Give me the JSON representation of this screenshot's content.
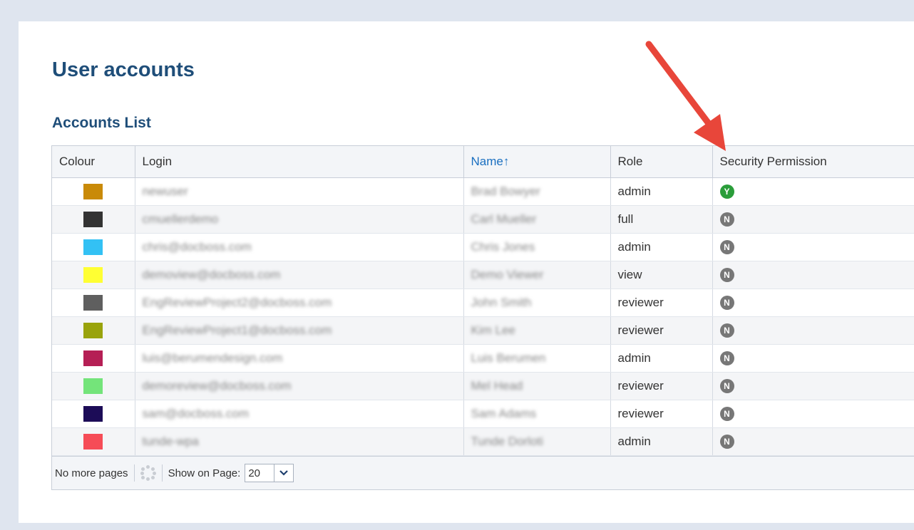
{
  "page": {
    "title": "User accounts",
    "section_title": "Accounts List"
  },
  "table": {
    "columns": {
      "colour": "Colour",
      "login": "Login",
      "name": "Name",
      "name_sort_indicator": "↑",
      "role": "Role",
      "security": "Security Permission"
    },
    "rows": [
      {
        "color": "#c98a08",
        "login": "newuser",
        "name": "Brad Bowyer",
        "role": "admin",
        "perm": "Y"
      },
      {
        "color": "#333333",
        "login": "cmuellerdemo",
        "name": "Carl Mueller",
        "role": "full",
        "perm": "N"
      },
      {
        "color": "#33c1f4",
        "login": "chris@docboss.com",
        "name": "Chris Jones",
        "role": "admin",
        "perm": "N"
      },
      {
        "color": "#ffff33",
        "login": "demoview@docboss.com",
        "name": "Demo Viewer",
        "role": "view",
        "perm": "N"
      },
      {
        "color": "#5f5f5f",
        "login": "EngReviewProject2@docboss.com",
        "name": "John Smith",
        "role": "reviewer",
        "perm": "N"
      },
      {
        "color": "#99a30c",
        "login": "EngReviewProject1@docboss.com",
        "name": "Kim Lee",
        "role": "reviewer",
        "perm": "N"
      },
      {
        "color": "#b51f55",
        "login": "luis@berumendesign.com",
        "name": "Luis Berumen",
        "role": "admin",
        "perm": "N"
      },
      {
        "color": "#74e47a",
        "login": "demoreview@docboss.com",
        "name": "Mel Head",
        "role": "reviewer",
        "perm": "N"
      },
      {
        "color": "#1c0c57",
        "login": "sam@docboss.com",
        "name": "Sam Adams",
        "role": "reviewer",
        "perm": "N"
      },
      {
        "color": "#f64c57",
        "login": "tunde-wpa",
        "name": "Tunde Dorloti",
        "role": "admin",
        "perm": "N"
      }
    ]
  },
  "footer": {
    "pages_text": "No more pages",
    "show_on_page_label": "Show on Page:",
    "page_size": "20"
  },
  "annotation": {
    "arrow_color": "#e8463a"
  }
}
